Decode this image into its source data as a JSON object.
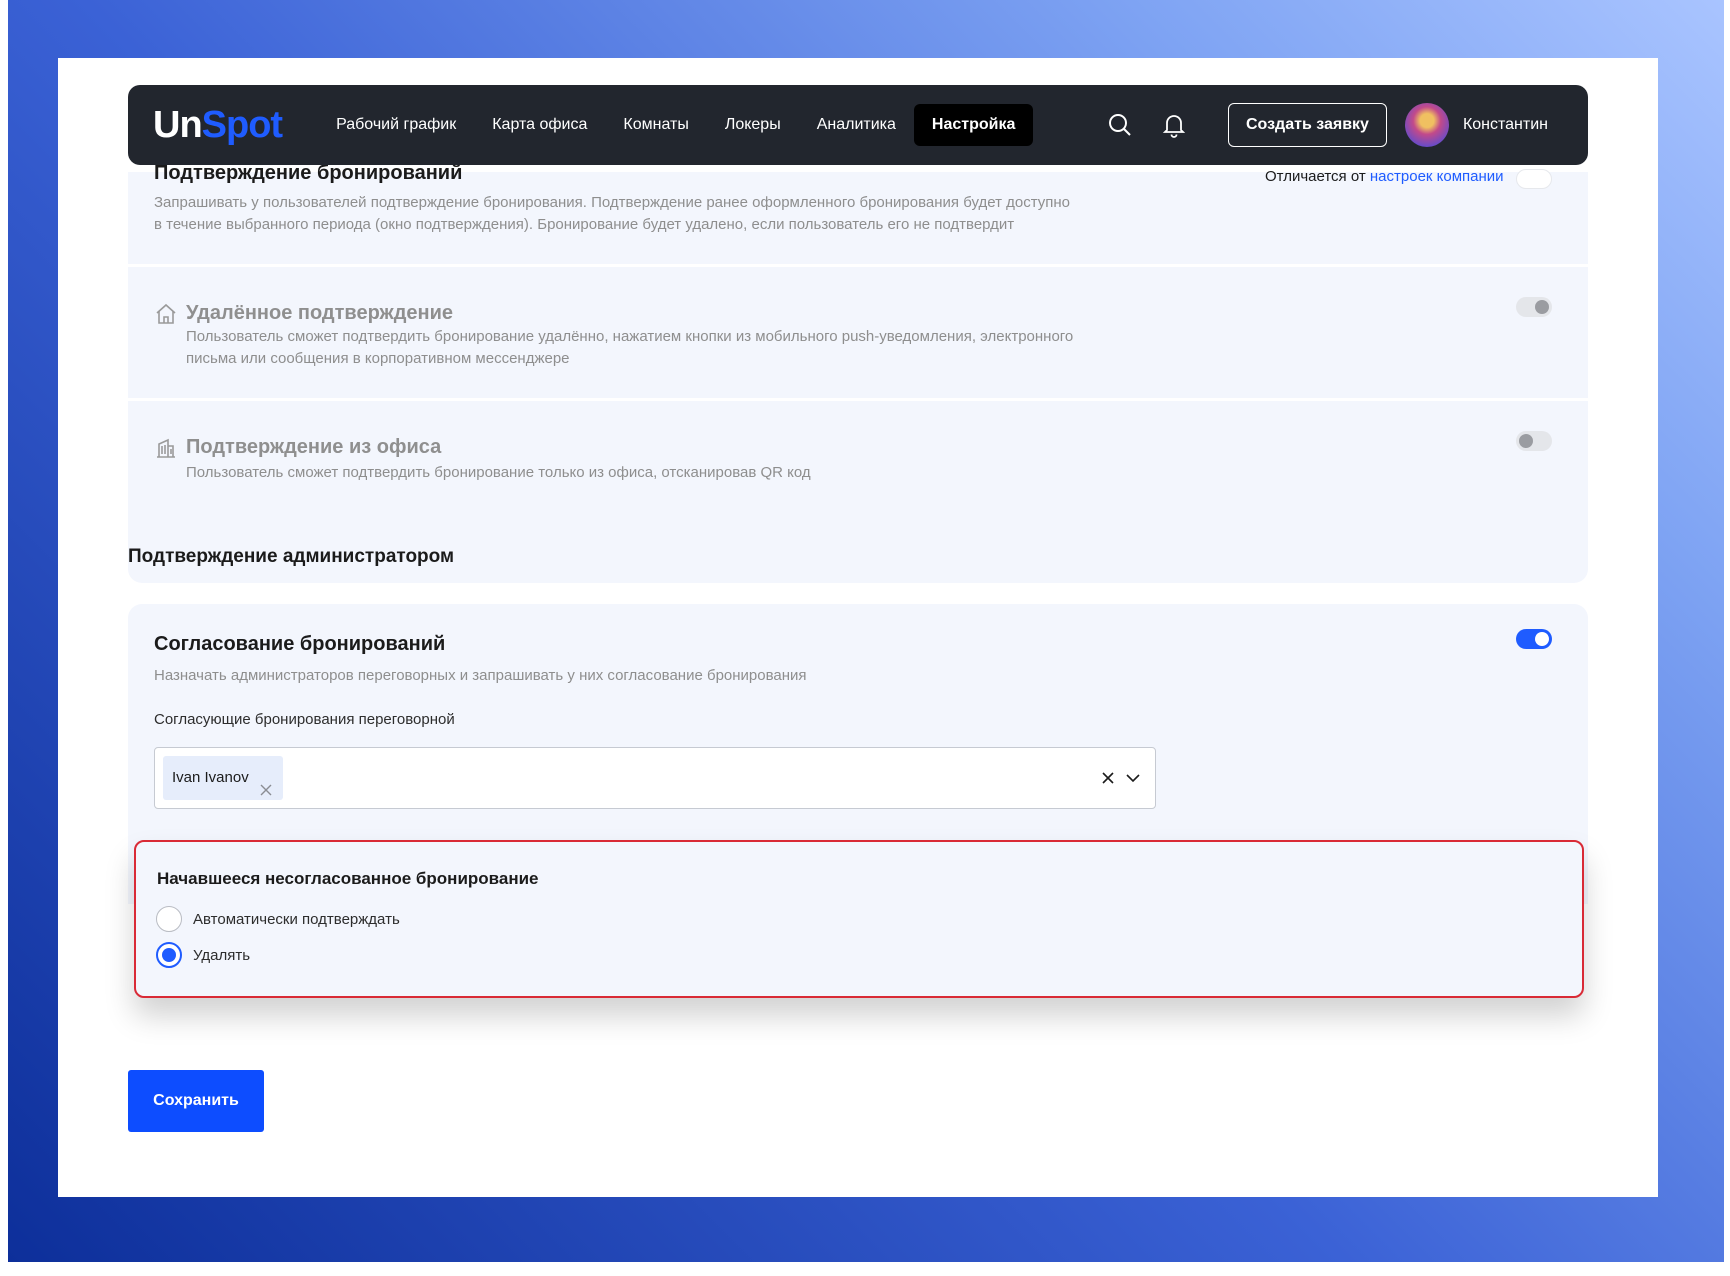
{
  "header": {
    "logo_part1": "Un",
    "logo_part2": "Spot",
    "nav": [
      "Рабочий график",
      "Карта офиса",
      "Комнаты",
      "Локеры",
      "Аналитика",
      "Настройка"
    ],
    "active_nav": "Настройка",
    "create_button": "Создать заявку",
    "user_name": "Константин"
  },
  "booking_confirmation": {
    "title": "Подтверждение бронирований",
    "description": "Запрашивать у пользователей подтверждение бронирования. Подтверждение ранее оформленного бронирования будет доступно в течение выбранного периода (окно подтверждения). Бронирование будет удалено, если пользователь его не подтвердит",
    "differs_prefix": "Отличается от",
    "differs_link": "настроек компании",
    "enabled": false
  },
  "remote_confirmation": {
    "title": "Удалённое подтверждение",
    "description": "Пользователь сможет подтвердить бронирование удалённо, нажатием кнопки из мобильного push-уведомления, электронного письма или сообщения в корпоративном мессенджере",
    "enabled": true
  },
  "office_confirmation": {
    "title": "Подтверждение из офиса",
    "description": "Пользователь сможет подтвердить бронирование только из офиса, отсканировав QR код",
    "enabled": false
  },
  "admin_section": {
    "title": "Подтверждение администратором"
  },
  "approval": {
    "title": "Согласование бронирований",
    "description": "Назначать администраторов переговорных и запрашивать у них согласование бронирования",
    "enabled": true,
    "approvers_label": "Согласующие бронирования переговорной",
    "approvers": [
      "Ivan Ivanov"
    ]
  },
  "unapproved_started": {
    "title": "Начавшееся несогласованное бронирование",
    "options": [
      "Автоматически подтверждать",
      "Удалять"
    ],
    "selected": "Удалять"
  },
  "save_button": "Сохранить",
  "colors": {
    "accent": "#1f5cff",
    "header_bg": "#22262e",
    "highlight_border": "#d92a36",
    "card_bg": "#f3f6fd"
  }
}
